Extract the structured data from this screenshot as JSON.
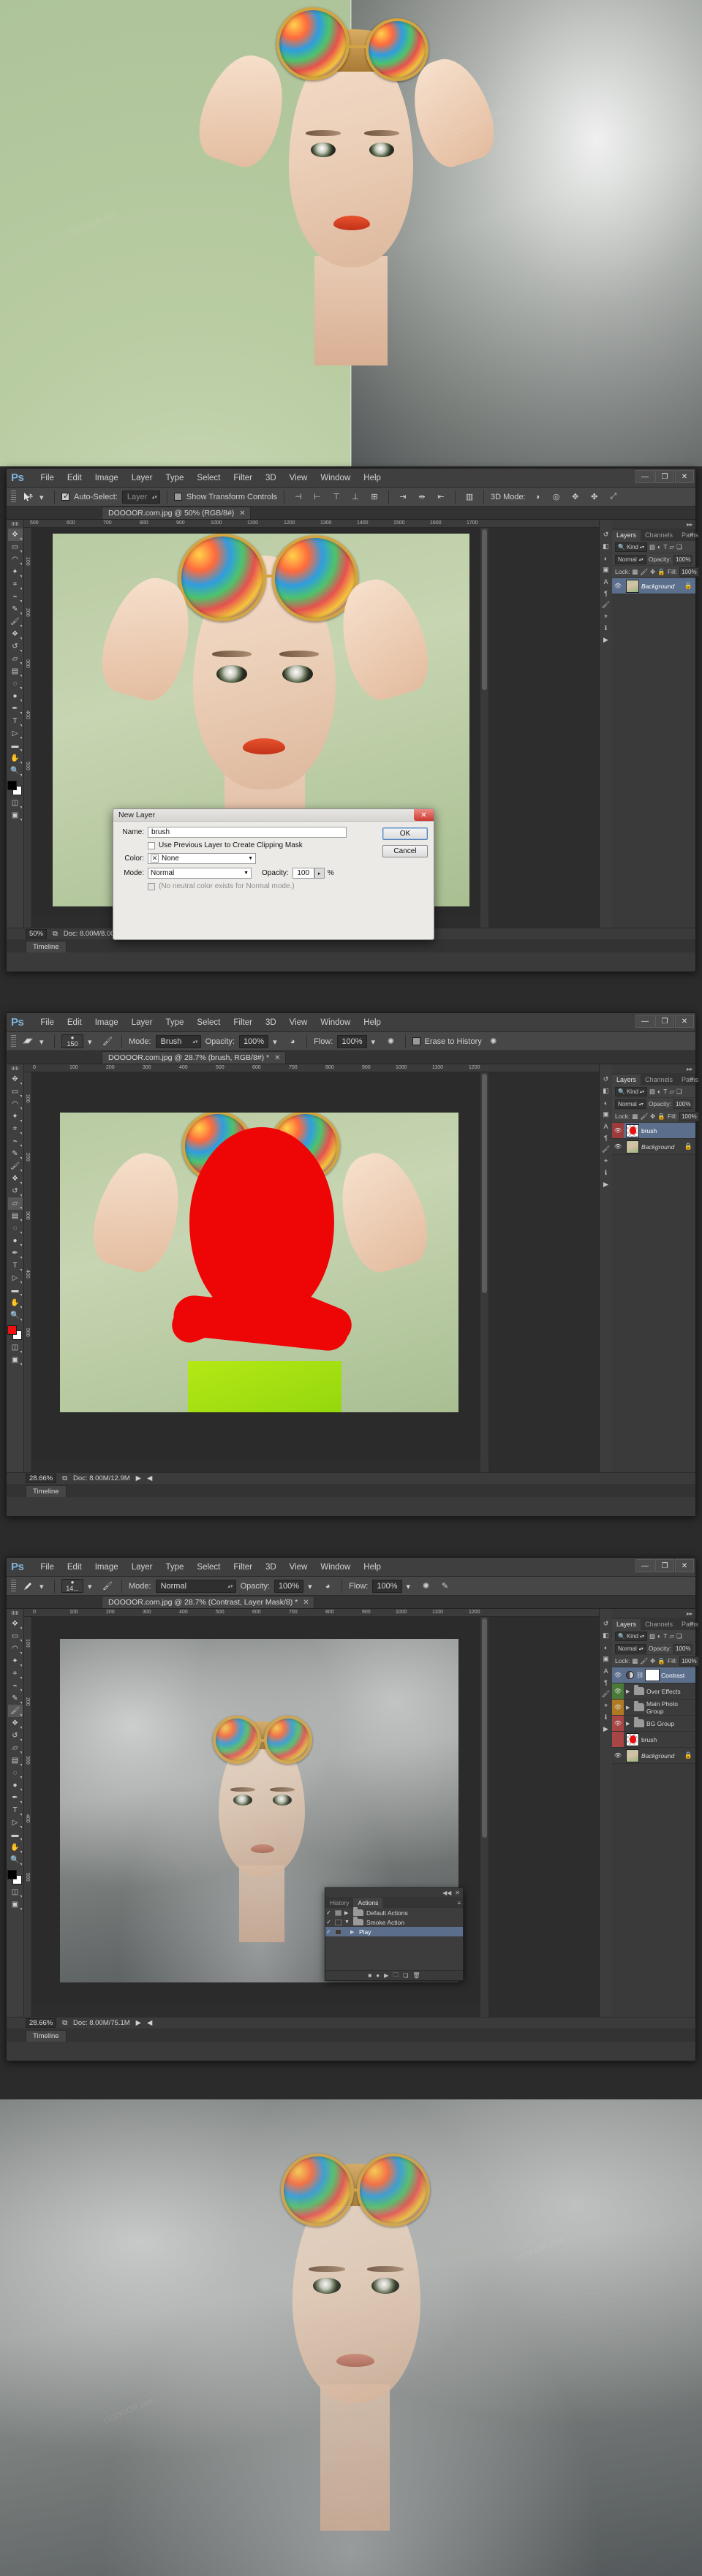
{
  "app": {
    "logo": "Ps",
    "menus": [
      "File",
      "Edit",
      "Image",
      "Layer",
      "Type",
      "Select",
      "Filter",
      "3D",
      "View",
      "Window",
      "Help"
    ],
    "window_buttons": {
      "minimize": "—",
      "maximize": "❐",
      "close": "✕"
    }
  },
  "watermark": "DOOOOR.com",
  "window1": {
    "tab_title": "DOOOOR.com.jpg @ 50% (RGB/8#)",
    "close_glyph": "✕",
    "options": {
      "tool_icon": "move-tool-icon",
      "auto_select_label": "Auto-Select:",
      "auto_select_checked": true,
      "auto_select_value": "Layer",
      "show_transform_label": "Show Transform Controls",
      "show_transform_checked": false,
      "mode3d_label": "3D Mode:"
    },
    "ruler_ticks": [
      "500",
      "600",
      "700",
      "800",
      "900",
      "1000",
      "1100",
      "1200",
      "1300",
      "1400",
      "1500",
      "1600",
      "1700"
    ],
    "ruler_v_ticks": [
      "100",
      "200",
      "300",
      "400",
      "500"
    ],
    "status": {
      "zoom": "50%",
      "doc": "Doc: 8.00M/8.00M"
    },
    "timeline_tab": "Timeline",
    "panels": {
      "tabs": [
        "Layers",
        "Channels",
        "Paths"
      ],
      "active_tab": "Layers",
      "kind_label": "Kind",
      "blend_mode": "Normal",
      "opacity_label": "Opacity:",
      "opacity_value": "100%",
      "lock_label": "Lock:",
      "fill_label": "Fill:",
      "fill_value": "100%",
      "layers": [
        {
          "name": "Background",
          "visible": true,
          "locked": true,
          "selected": true,
          "thumb": "photo",
          "italic": true
        }
      ]
    },
    "dialog": {
      "title": "New Layer",
      "close_glyph": "✕",
      "name_label": "Name:",
      "name_value": "brush",
      "clipping_label": "Use Previous Layer to Create Clipping Mask",
      "clipping_checked": false,
      "color_label": "Color:",
      "color_value": "None",
      "color_swatch_glyph": "✕",
      "mode_label": "Mode:",
      "mode_value": "Normal",
      "opacity_label": "Opacity:",
      "opacity_value": "100",
      "percent": "%",
      "neutral_note": "(No neutral color exists for Normal mode.)",
      "ok_label": "OK",
      "cancel_label": "Cancel"
    }
  },
  "window2": {
    "tab_title": "DOOOOR.com.jpg @ 28.7% (brush, RGB/8#) *",
    "close_glyph": "✕",
    "options": {
      "tool_icon": "eraser-tool-icon",
      "brush_size": "150",
      "mode_label": "Mode:",
      "mode_value": "Brush",
      "opacity_label": "Opacity:",
      "opacity_value": "100%",
      "flow_label": "Flow:",
      "flow_value": "100%",
      "erase_history_label": "Erase to History",
      "erase_history_checked": false
    },
    "ruler_ticks": [
      "0",
      "100",
      "200",
      "300",
      "400",
      "500",
      "600",
      "700",
      "800",
      "900",
      "1000",
      "1100",
      "1200"
    ],
    "status": {
      "zoom": "28.66%",
      "doc": "Doc: 8.00M/12.9M"
    },
    "timeline_tab": "Timeline",
    "panels": {
      "tabs": [
        "Layers",
        "Channels",
        "Paths"
      ],
      "active_tab": "Layers",
      "kind_label": "Kind",
      "blend_mode": "Normal",
      "opacity_label": "Opacity:",
      "opacity_value": "100%",
      "lock_label": "Lock:",
      "fill_label": "Fill:",
      "fill_value": "100%",
      "layers": [
        {
          "name": "brush",
          "visible": true,
          "locked": false,
          "selected": true,
          "thumb": "mask-red",
          "eye_bg": "red",
          "italic": false
        },
        {
          "name": "Background",
          "visible": true,
          "locked": true,
          "selected": false,
          "thumb": "photo",
          "italic": true
        }
      ]
    }
  },
  "window3": {
    "tab_title": "DOOOOR.com.jpg @ 28.7% (Contrast, Layer Mask/8) *",
    "close_glyph": "✕",
    "options": {
      "tool_icon": "brush-tool-icon",
      "brush_size": "14...",
      "mode_label": "Mode:",
      "mode_value": "Normal",
      "opacity_label": "Opacity:",
      "opacity_value": "100%",
      "flow_label": "Flow:",
      "flow_value": "100%"
    },
    "ruler_ticks": [
      "0",
      "100",
      "200",
      "300",
      "400",
      "500",
      "600",
      "700",
      "800",
      "900",
      "1000",
      "1100",
      "1200"
    ],
    "status": {
      "zoom": "28.66%",
      "doc": "Doc: 8.00M/75.1M"
    },
    "timeline_tab": "Timeline",
    "panels": {
      "tabs": [
        "Layers",
        "Channels",
        "Paths"
      ],
      "active_tab": "Layers",
      "kind_label": "Kind",
      "blend_mode": "Normal",
      "opacity_label": "Opacity:",
      "opacity_value": "100%",
      "lock_label": "Lock:",
      "fill_label": "Fill:",
      "fill_value": "100%",
      "layers": [
        {
          "name": "Contrast",
          "visible": true,
          "locked": false,
          "selected": true,
          "thumb": "white-mask",
          "type": "adjustment",
          "italic": false
        },
        {
          "name": "Over Effects",
          "visible": true,
          "locked": false,
          "selected": false,
          "thumb": "folder",
          "type": "group",
          "eye_bg": "green",
          "italic": false
        },
        {
          "name": "Main Photo Group",
          "visible": true,
          "locked": false,
          "selected": false,
          "thumb": "folder",
          "type": "group",
          "eye_bg": "orange",
          "italic": false
        },
        {
          "name": "BG Group",
          "visible": true,
          "locked": false,
          "selected": false,
          "thumb": "folder",
          "type": "group",
          "eye_bg": "redd",
          "italic": false
        },
        {
          "name": "brush",
          "visible": false,
          "locked": false,
          "selected": false,
          "thumb": "mask-red",
          "eye_bg": "redd",
          "italic": false
        },
        {
          "name": "Background",
          "visible": true,
          "locked": true,
          "selected": false,
          "thumb": "photo",
          "italic": true
        }
      ]
    },
    "actions_panel": {
      "tabs": [
        "History",
        "Actions"
      ],
      "active_tab": "Actions",
      "collapse_glyph": "◀◀",
      "close_glyph": "✕",
      "rows": [
        {
          "checked": true,
          "toggle": "minus",
          "arrow": "▶",
          "icon": "folder",
          "label": "Default Actions",
          "indent": 0,
          "selected": false
        },
        {
          "checked": true,
          "toggle": "empty",
          "arrow": "▼",
          "icon": "folder-open",
          "label": "Smoke Action",
          "indent": 0,
          "selected": false
        },
        {
          "checked": true,
          "toggle": "empty",
          "arrow": "▶",
          "icon": "none",
          "label": "Play",
          "indent": 1,
          "selected": true
        }
      ]
    }
  }
}
